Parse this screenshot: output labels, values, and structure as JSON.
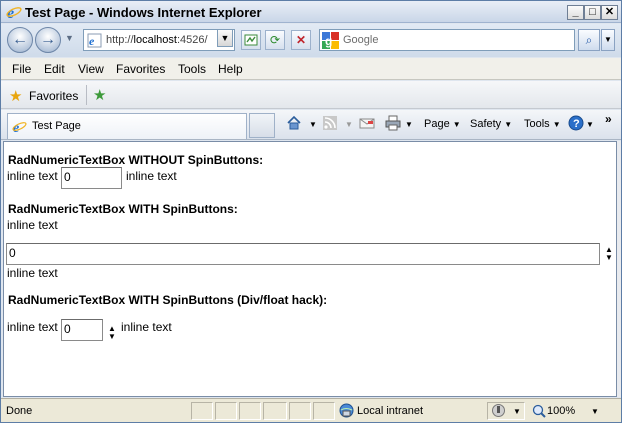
{
  "window": {
    "title": "Test Page - Windows Internet Explorer",
    "controls": {
      "minimize": "_",
      "maximize": "□",
      "close": "✕"
    }
  },
  "address_bar": {
    "url_prefix": "http://",
    "url_host": "localhost",
    "url_rest": ":4526/",
    "search_placeholder": "Google"
  },
  "menu": {
    "items": [
      {
        "label": "File"
      },
      {
        "label": "Edit"
      },
      {
        "label": "View"
      },
      {
        "label": "Favorites"
      },
      {
        "label": "Tools"
      },
      {
        "label": "Help"
      }
    ]
  },
  "favorites_bar": {
    "label": "Favorites"
  },
  "tabs": [
    {
      "label": "Test Page"
    }
  ],
  "command_bar": {
    "page": "Page",
    "safety": "Safety",
    "tools": "Tools",
    "more": "»"
  },
  "content": {
    "section1": {
      "heading": "RadNumericTextBox WITHOUT SpinButtons:",
      "text_before": "inline text",
      "value": "0",
      "text_after": "inline text"
    },
    "section2": {
      "heading": "RadNumericTextBox WITH SpinButtons:",
      "text_before": "inline text",
      "value": "0",
      "text_after": "inline text"
    },
    "section3": {
      "heading": "RadNumericTextBox WITH SpinButtons (Div/float hack):",
      "text_before": "inline text",
      "value": "0",
      "text_after": "inline text"
    }
  },
  "status_bar": {
    "status": "Done",
    "zone": "Local intranet",
    "zoom": "100%"
  },
  "colors": {
    "ie_blue": "#1e6fd1",
    "status_bg": "#ece9d8",
    "menu_bg": "#f1f0ea"
  }
}
